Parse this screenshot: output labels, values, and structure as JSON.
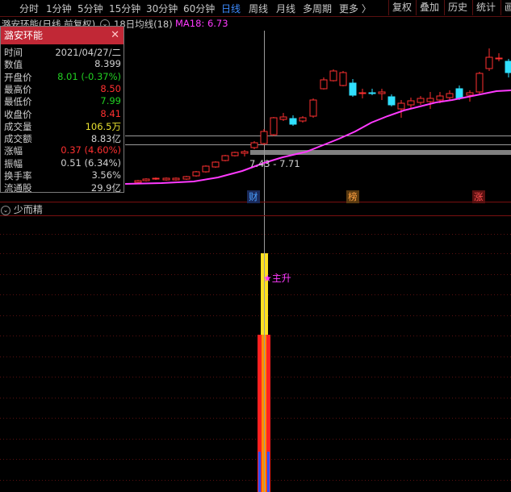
{
  "toolbar": {
    "periods": [
      {
        "label": "分时",
        "active": false
      },
      {
        "label": "1分钟",
        "active": false
      },
      {
        "label": "5分钟",
        "active": false
      },
      {
        "label": "15分钟",
        "active": false
      },
      {
        "label": "30分钟",
        "active": false
      },
      {
        "label": "60分钟",
        "active": false
      },
      {
        "label": "日线",
        "active": true
      },
      {
        "label": "周线",
        "active": false
      },
      {
        "label": "月线",
        "active": false
      },
      {
        "label": "多周期",
        "active": false
      },
      {
        "label": "更多",
        "active": false
      }
    ],
    "more_chevron": "〉",
    "right_buttons": [
      "复权",
      "叠加",
      "历史",
      "统计",
      "画"
    ]
  },
  "chart_header": {
    "stock_title": "潞安环能(日线 前复权)",
    "ma_toggle_icon": "chevron-down-icon",
    "ma_label": "18日均线(18)",
    "ma_value": "MA18: 6.73",
    "ma_color": "#ff3aff"
  },
  "info_panel": {
    "title": "潞安环能",
    "rows": [
      {
        "label": "时间",
        "value": "2021/04/27/二",
        "color": "#d0d0d0"
      },
      {
        "label": "数值",
        "value": "8.399",
        "color": "#d0d0d0"
      },
      {
        "label": "开盘价",
        "value": "8.01 (-0.37%)",
        "color": "#22d022"
      },
      {
        "label": "最高价",
        "value": "8.50",
        "color": "#ff3030"
      },
      {
        "label": "最低价",
        "value": "7.99",
        "color": "#22d022"
      },
      {
        "label": "收盘价",
        "value": "8.41",
        "color": "#ff3030"
      },
      {
        "label": "成交量",
        "value": "106.5万",
        "color": "#e8e030"
      },
      {
        "label": "成交额",
        "value": "8.83亿",
        "color": "#d0d0d0"
      },
      {
        "label": "涨幅",
        "value": "0.37 (4.60%)",
        "color": "#ff3030"
      },
      {
        "label": "振幅",
        "value": "0.51 (6.34%)",
        "color": "#d0d0d0"
      },
      {
        "label": "换手率",
        "value": "3.56%",
        "color": "#d0d0d0"
      },
      {
        "label": "流通股",
        "value": "29.9亿",
        "color": "#d0d0d0"
      }
    ]
  },
  "price_chart": {
    "price_range_label": "7.43 - 7.71",
    "event_markers": [
      {
        "label": "财",
        "color": "#4aa0ff"
      },
      {
        "label": "榜",
        "color": "#ffa040"
      },
      {
        "label": "涨",
        "color": "#ff5050"
      }
    ],
    "up_color": "#ff3030",
    "down_color": "#30e0ff",
    "ma_color": "#ff3aff"
  },
  "indicator": {
    "title": "少而精",
    "signal_label": "★主升",
    "signal_color": "#ff3aff"
  }
}
